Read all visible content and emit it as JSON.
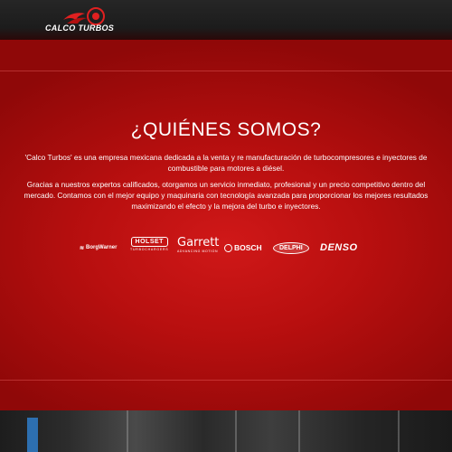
{
  "header": {
    "logo_text_left": "CALCO",
    "logo_text_right": "TURBOS"
  },
  "about": {
    "title": "¿QUIÉNES SOMOS?",
    "paragraph1": "'Calco Turbos' es una empresa mexicana dedicada a la venta y re manufacturación de turbocompresores e inyectores de combustible para motores a diésel.",
    "paragraph2": "Gracias a nuestros expertos calificados, otorgamos un servicio inmediato, profesional y un precio competitivo dentro del mercado. Contamos con el mejor equipo y maquinaria con tecnología avanzada para proporcionar los mejores resultados maximizando el efecto y la mejora del turbo e inyectores."
  },
  "brands": {
    "borgwarner": "BorgWarner",
    "holset": "HOLSET",
    "holset_sub": "TURBOCHARGERS",
    "garrett": "Garrett",
    "garrett_sub": "ADVANCING MOTION",
    "bosch": "BOSCH",
    "delphi": "DELPHI",
    "denso": "DENSO"
  },
  "colors": {
    "accent_red": "#c81414",
    "header_bg": "#222222"
  }
}
